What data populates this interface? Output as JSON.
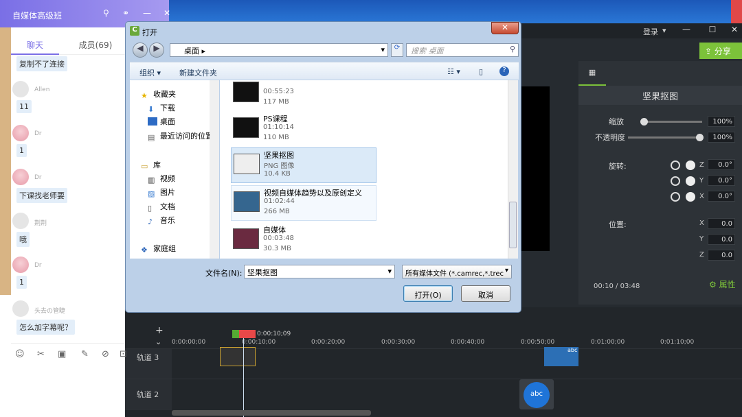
{
  "colors": {
    "accent_green": "#7cc23a",
    "chat_purple": "#7a6fe6",
    "selection": "#dbeaf8"
  },
  "chat": {
    "title": "自媒体高级班",
    "tabs": {
      "chat": "聊天",
      "members": "成员(69)"
    },
    "messages": [
      {
        "user": "",
        "text": "复制不了连接"
      },
      {
        "user": "Allen",
        "text": "11"
      },
      {
        "user": "Dr",
        "text": "1"
      },
      {
        "user": "Dr",
        "text": "下课找老师要"
      },
      {
        "user": "荆荆",
        "text": "哦"
      },
      {
        "user": "Dr",
        "text": "1"
      },
      {
        "user": "头去の管睫",
        "text": "怎么加字幕呢？"
      }
    ]
  },
  "camtasia": {
    "login": "登录",
    "share": "分享",
    "properties": {
      "title": "坚果抠图",
      "scale_label": "缩放",
      "scale": "100%",
      "opacity_label": "不透明度",
      "opacity": "100%",
      "rotation_label": "旋转:",
      "rot_z": "0.0°",
      "rot_y": "0.0°",
      "rot_x": "0.0°",
      "position_label": "位置:",
      "pos_x": "0.0",
      "pos_y": "0.0",
      "pos_z": "0.0",
      "axis_x": "X",
      "axis_y": "Y",
      "axis_z": "Z",
      "attributes_button": "属性"
    },
    "time_current": "00:10",
    "time_sep": "/",
    "time_total": "03:48",
    "timeline": {
      "playhead_time": "0:00:10;09",
      "ticks": [
        "0:00:00;00",
        "0:00:10;00",
        "0:00:20;00",
        "0:00:30;00",
        "0:00:40;00",
        "0:00:50;00",
        "0:01:00;00",
        "0:01:10;00"
      ],
      "track3": "轨道 3",
      "track2": "轨道 2",
      "clip_label": "abc"
    }
  },
  "dialog": {
    "title": "打开",
    "address": "桌面",
    "search_placeholder": "搜索 桌面",
    "toolbar": {
      "organize": "组织",
      "new_folder": "新建文件夹"
    },
    "nav": {
      "favorites": "收藏夹",
      "downloads": "下载",
      "desktop": "桌面",
      "recent": "最近访问的位置",
      "library": "库",
      "videos": "视频",
      "pictures": "图片",
      "documents": "文档",
      "music": "音乐",
      "homegroup": "家庭组"
    },
    "files": [
      {
        "name": "",
        "sub": "00:55:23",
        "size": "117 MB"
      },
      {
        "name": "PS课程",
        "sub": "01:10:14",
        "size": "110 MB"
      },
      {
        "name": "坚果抠图",
        "sub": "PNG 图像",
        "size": "10.4 KB"
      },
      {
        "name": "视频自媒体趋势以及原创定义",
        "sub": "01:02:44",
        "size": "266 MB"
      },
      {
        "name": "自媒体",
        "sub": "00:03:48",
        "size": "30.3 MB"
      }
    ],
    "filename_label": "文件名(N):",
    "filename_value": "坚果抠图",
    "filetype_value": "所有媒体文件 (*.camrec,*.trec",
    "open_button": "打开(O)",
    "cancel_button": "取消"
  }
}
